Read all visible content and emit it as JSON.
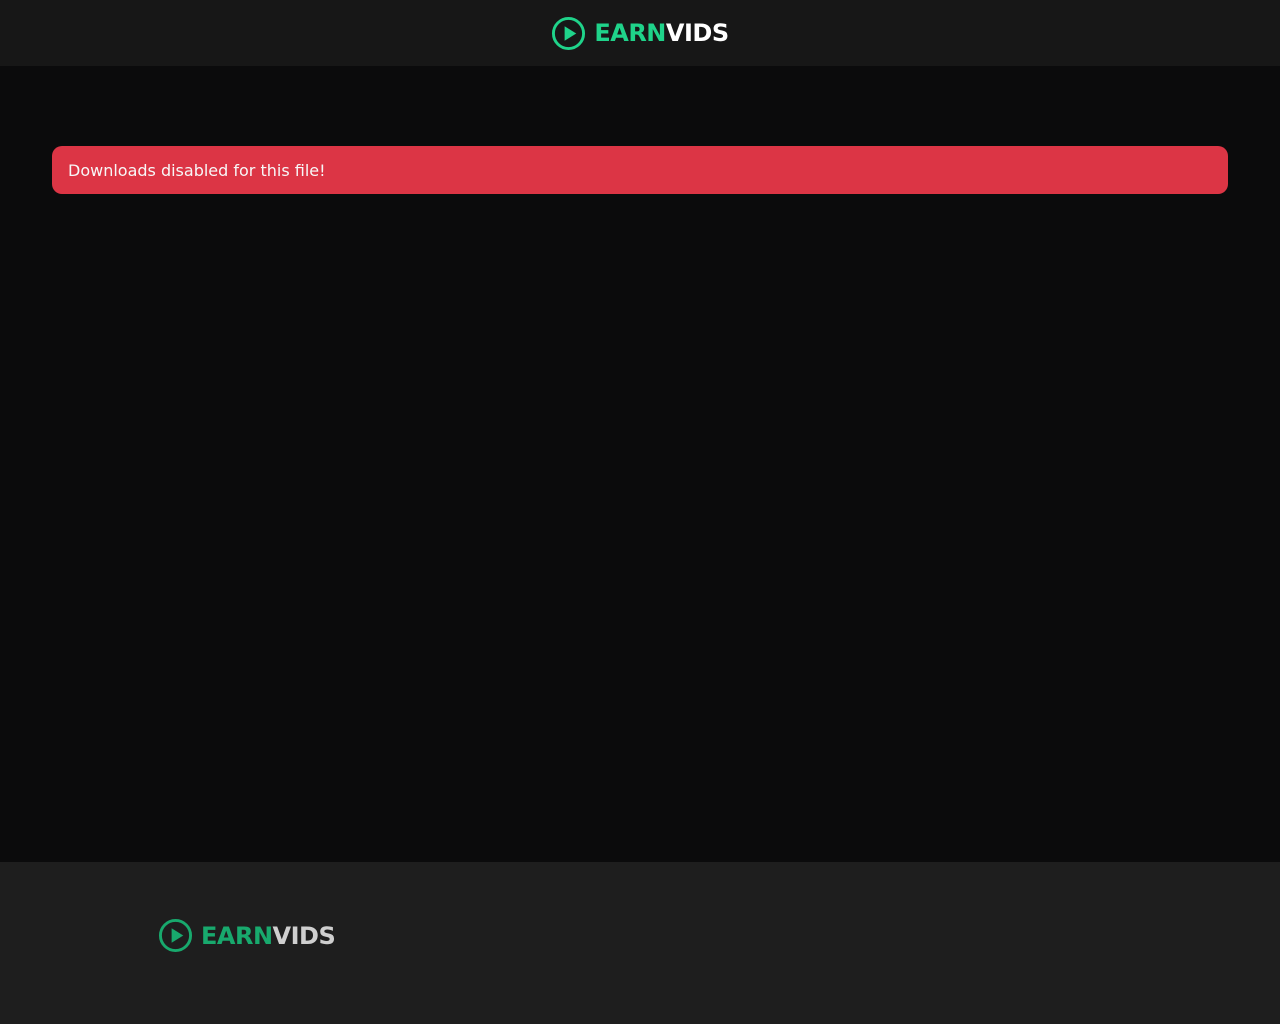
{
  "brand": {
    "name_part1": "EARN",
    "name_part2": "VIDS",
    "accent_color": "#1fd38a",
    "footer_accent_color": "#18a96d",
    "text_color": "#ffffff",
    "footer_text_color": "#cfcfcf",
    "icon": "play-circle-icon"
  },
  "alert": {
    "message": "Downloads disabled for this file!",
    "color": "#dc3545"
  },
  "colors": {
    "header_bg": "#171717",
    "main_bg": "#0b0b0c",
    "footer_bg": "#1e1e1e"
  }
}
